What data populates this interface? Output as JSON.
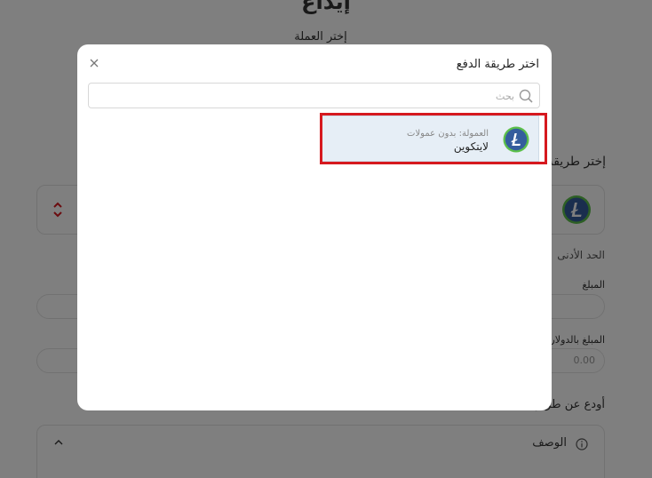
{
  "page": {
    "title": "إيداع",
    "choose_currency": "إختر العملة",
    "choose_payment_method": "إختر طريقة",
    "min_limit": "الحد الأدنى",
    "amount_label": "المبلغ",
    "usd_amount_label": "المبلغ بالدولار",
    "usd_amount_value": "0.00",
    "deposit_via": "أودع عن طريق",
    "description_title": "الوصف"
  },
  "modal": {
    "title": "اختر طريقة الدفع",
    "search_placeholder": "بحث",
    "options": [
      {
        "fee": "العمولة: بدون عمولات",
        "name": "لايتكوين",
        "icon": "litecoin-icon",
        "selected": true
      }
    ]
  },
  "colors": {
    "highlight": "#d6191f",
    "option_bg": "#e6eef6",
    "litecoin_blue": "#345d9d",
    "litecoin_ring": "#5bbf4a"
  }
}
